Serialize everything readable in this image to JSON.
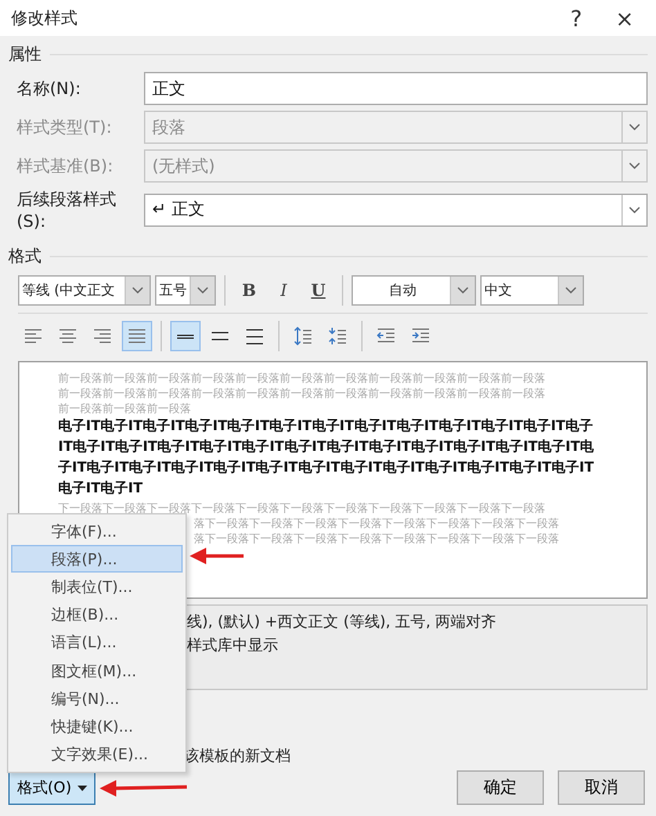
{
  "window": {
    "title": "修改样式",
    "help": "?",
    "close": "×"
  },
  "properties": {
    "heading": "属性",
    "fields": [
      {
        "label": "名称(N):",
        "kind": "text",
        "value": "正文",
        "disabled": false
      },
      {
        "label": "样式类型(T):",
        "kind": "select",
        "value": "段落",
        "disabled": true
      },
      {
        "label": "样式基准(B):",
        "kind": "select",
        "value": "(无样式)",
        "disabled": true
      },
      {
        "label": "后续段落样式(S):",
        "kind": "select",
        "value": "↵ 正文",
        "disabled": false
      }
    ]
  },
  "format": {
    "heading": "格式",
    "font": "等线 (中文正文",
    "size": "五号",
    "bold": "B",
    "italic": "I",
    "underline": "U",
    "text_color": "自动",
    "language": "中文",
    "alignment": [
      {
        "kind": "left",
        "selected": false
      },
      {
        "kind": "center",
        "selected": false
      },
      {
        "kind": "right",
        "selected": false
      },
      {
        "kind": "justify",
        "selected": true
      }
    ],
    "line_spacing": [
      {
        "kind": "single",
        "selected": true
      },
      {
        "kind": "one-half",
        "selected": false
      },
      {
        "kind": "double",
        "selected": false
      }
    ]
  },
  "preview": {
    "previous_lines": [
      "前一段落前一段落前一段落前一段落前一段落前一段落前一段落前一段落前一段落前一段落前一段落",
      "前一段落前一段落前一段落前一段落前一段落前一段落前一段落前一段落前一段落前一段落前一段落",
      "前一段落前一段落前一段落"
    ],
    "sample_lines": [
      "电子IT电子IT电子IT电子IT电子IT电子IT电子IT电子IT电子IT电子IT电子IT电子IT电子",
      "IT电子IT电子IT电子IT电子IT电子IT电子IT电子IT电子IT电子IT电子IT电子IT电子IT电",
      "子IT电子IT电子IT电子IT电子IT电子IT电子IT电子IT电子IT电子IT电子IT电子IT电子IT",
      "电子IT电子IT"
    ],
    "next_lines": [
      {
        "text": "下一段落下一段落下一段落下一段落下一段落下一段落下一段落下一段落下一段落下一段落下一段落",
        "covered": false
      },
      {
        "text": "落下一段落下一段落下一段落下一段落下一段落下一段落下一段落下一段落",
        "covered": true
      },
      {
        "text": "落下一段落下一段落下一段落下一段落下一段落下一段落下一段落下一段落",
        "covered": true
      }
    ]
  },
  "description": {
    "lines": [
      "线), (默认) +西文正文 (等线), 五号, 两端对齐",
      "样式库中显示"
    ]
  },
  "scope_option": "该模板的新文档",
  "menu": {
    "items": [
      {
        "label": "字体(F)...",
        "selected": false
      },
      {
        "label": "段落(P)...",
        "selected": true
      },
      {
        "label": "制表位(T)...",
        "selected": false
      },
      {
        "label": "边框(B)...",
        "selected": false
      },
      {
        "label": "语言(L)...",
        "selected": false
      },
      {
        "label": "图文框(M)...",
        "selected": false
      },
      {
        "label": "编号(N)...",
        "selected": false
      },
      {
        "label": "快捷键(K)...",
        "selected": false
      },
      {
        "label": "文字效果(E)...",
        "selected": false
      }
    ]
  },
  "format_button": "格式(O)",
  "buttons": [
    "确定",
    "取消"
  ]
}
